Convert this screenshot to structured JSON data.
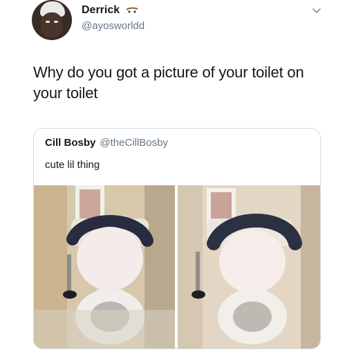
{
  "tweet": {
    "display_name": "Derrick",
    "name_emoji": "skateboard-emoji",
    "handle": "@ayosworldd",
    "text": "Why do you got a picture of your toilet on your toilet"
  },
  "quoted_tweet": {
    "display_name": "Cill Bosby",
    "handle": "@theCillBosby",
    "text": "cute lil thing",
    "photos": [
      "toilet-photo-left",
      "toilet-photo-right"
    ]
  },
  "icons": {
    "more": "chevron-down-icon"
  },
  "colors": {
    "text": "#14171a",
    "secondary": "#657786",
    "border": "#d6dde3"
  }
}
